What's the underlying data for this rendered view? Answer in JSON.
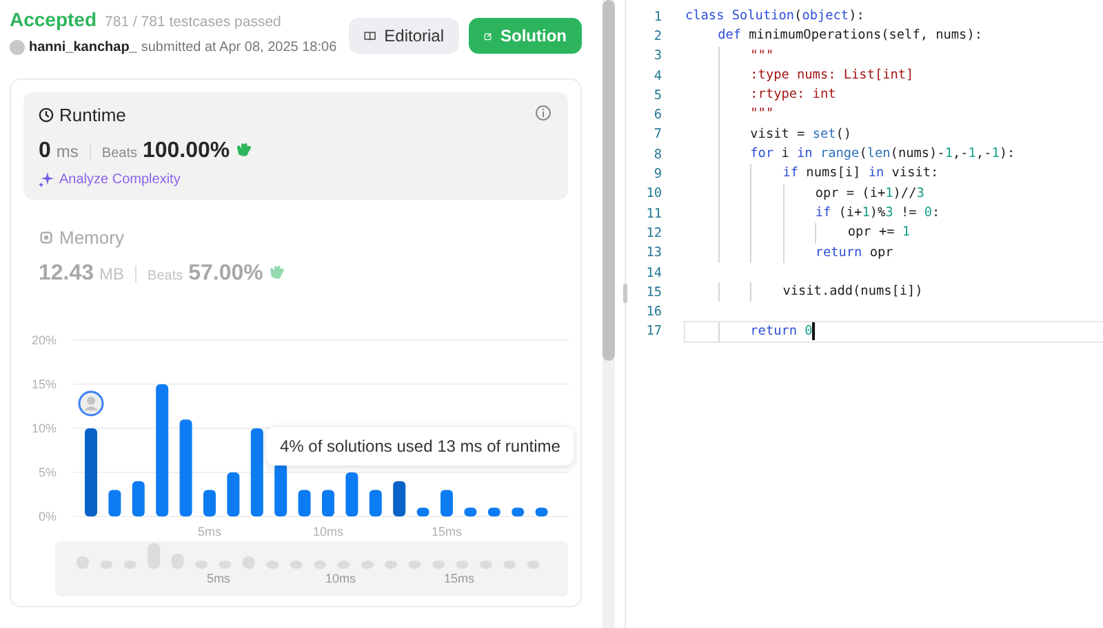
{
  "header": {
    "status": "Accepted",
    "testcases": "781 / 781 testcases passed",
    "user": "hanni_kanchap_",
    "submitted": "submitted at Apr 08, 2025 18:06"
  },
  "buttons": [
    {
      "label": "Editorial",
      "kind": "secondary"
    },
    {
      "label": "Solution",
      "kind": "primary"
    }
  ],
  "metrics": [
    {
      "kind": "runtime",
      "title": "Runtime",
      "value": "0",
      "unit": "ms",
      "beats_label": "Beats",
      "beats": "100.00%",
      "selected": true,
      "link": "Analyze Complexity"
    },
    {
      "kind": "memory",
      "title": "Memory",
      "value": "12.43",
      "unit": "MB",
      "beats_label": "Beats",
      "beats": "57.00%",
      "selected": false
    }
  ],
  "distribution": {
    "tooltip": "4% of solutions used 13 ms of runtime",
    "navigator_labels": [
      "5ms",
      "10ms",
      "15ms"
    ],
    "chart_data": {
      "type": "bar",
      "stacked": true,
      "grid": true,
      "x": [
        0,
        1,
        2,
        3,
        4,
        5,
        6,
        7,
        8,
        9,
        10,
        11,
        12,
        13,
        14,
        15,
        16,
        17,
        18,
        19
      ],
      "series": [
        {
          "color": "#0d7cf2",
          "values": [
            null,
            3,
            4,
            15,
            11,
            3,
            5,
            10,
            6,
            3,
            3,
            5,
            3,
            null,
            1,
            3,
            1,
            1,
            1,
            1
          ]
        },
        {
          "color": "#0a63c9",
          "values": [
            10,
            null,
            null,
            null,
            null,
            null,
            null,
            null,
            null,
            null,
            null,
            null,
            null,
            4,
            null,
            null,
            null,
            null,
            null,
            null
          ]
        }
      ],
      "xlim": [
        -0.5,
        19.5
      ],
      "ylim": [
        0,
        20
      ],
      "yticks": [
        {
          "value": 0,
          "label": "0%"
        },
        {
          "value": 5,
          "label": "5%"
        },
        {
          "value": 10,
          "label": "10%"
        },
        {
          "value": 15,
          "label": "15%"
        },
        {
          "value": 20,
          "label": "20%"
        }
      ],
      "xticks": [
        {
          "value": 5,
          "label": "5ms"
        },
        {
          "value": 10,
          "label": "10ms"
        },
        {
          "value": 15,
          "label": "15ms"
        }
      ]
    }
  },
  "editor": {
    "lines": [
      {
        "number": "1",
        "active": false,
        "tokens": [
          {
            "kind": "kw",
            "text": "class"
          },
          {
            "kind": "kw",
            "text": " Solution"
          },
          {
            "kind": "plain",
            "text": "("
          },
          {
            "kind": "kw",
            "text": "object"
          },
          {
            "kind": "plain",
            "text": "):"
          }
        ]
      },
      {
        "number": "2",
        "active": false,
        "tokens": [
          {
            "kind": "kw",
            "text": "    def"
          },
          {
            "kind": "plain",
            "text": " minimumOperations(self, nums):"
          }
        ]
      },
      {
        "number": "3",
        "active": false,
        "tokens": [
          {
            "kind": "str",
            "text": "        \"\"\""
          }
        ]
      },
      {
        "number": "4",
        "active": false,
        "tokens": [
          {
            "kind": "str",
            "text": "        :type nums: List[int]"
          }
        ]
      },
      {
        "number": "5",
        "active": false,
        "tokens": [
          {
            "kind": "str",
            "text": "        :rtype: int"
          }
        ]
      },
      {
        "number": "6",
        "active": false,
        "tokens": [
          {
            "kind": "str",
            "text": "        \"\"\""
          }
        ]
      },
      {
        "number": "7",
        "active": false,
        "tokens": [
          {
            "kind": "plain",
            "text": "        visit = "
          },
          {
            "kind": "builtin",
            "text": "set"
          },
          {
            "kind": "plain",
            "text": "()"
          }
        ]
      },
      {
        "number": "8",
        "active": false,
        "tokens": [
          {
            "kind": "kw",
            "text": "        for"
          },
          {
            "kind": "plain",
            "text": " i "
          },
          {
            "kind": "kw",
            "text": "in"
          },
          {
            "kind": "builtin",
            "text": " range"
          },
          {
            "kind": "plain",
            "text": "("
          },
          {
            "kind": "builtin",
            "text": "len"
          },
          {
            "kind": "plain",
            "text": "(nums)-"
          },
          {
            "kind": "num",
            "text": "1"
          },
          {
            "kind": "plain",
            "text": ",-"
          },
          {
            "kind": "num",
            "text": "1"
          },
          {
            "kind": "plain",
            "text": ",-"
          },
          {
            "kind": "num",
            "text": "1"
          },
          {
            "kind": "plain",
            "text": "):"
          }
        ]
      },
      {
        "number": "9",
        "active": false,
        "tokens": [
          {
            "kind": "kw",
            "text": "            if"
          },
          {
            "kind": "plain",
            "text": " nums[i] "
          },
          {
            "kind": "kw",
            "text": "in"
          },
          {
            "kind": "plain",
            "text": " visit:"
          }
        ]
      },
      {
        "number": "10",
        "active": false,
        "tokens": [
          {
            "kind": "plain",
            "text": "                opr = (i+"
          },
          {
            "kind": "num",
            "text": "1"
          },
          {
            "kind": "plain",
            "text": ")//"
          },
          {
            "kind": "num",
            "text": "3"
          }
        ]
      },
      {
        "number": "11",
        "active": false,
        "tokens": [
          {
            "kind": "kw",
            "text": "                if"
          },
          {
            "kind": "plain",
            "text": " (i+"
          },
          {
            "kind": "num",
            "text": "1"
          },
          {
            "kind": "plain",
            "text": ")%"
          },
          {
            "kind": "num",
            "text": "3"
          },
          {
            "kind": "plain",
            "text": " != "
          },
          {
            "kind": "num",
            "text": "0"
          },
          {
            "kind": "plain",
            "text": ":"
          }
        ]
      },
      {
        "number": "12",
        "active": false,
        "tokens": [
          {
            "kind": "plain",
            "text": "                    opr += "
          },
          {
            "kind": "num",
            "text": "1"
          }
        ]
      },
      {
        "number": "13",
        "active": false,
        "tokens": [
          {
            "kind": "kw",
            "text": "                return"
          },
          {
            "kind": "plain",
            "text": " opr"
          }
        ]
      },
      {
        "number": "14",
        "active": false
      },
      {
        "number": "15",
        "active": false,
        "tokens": [
          {
            "kind": "plain",
            "text": "            visit.add(nums[i])"
          }
        ]
      },
      {
        "number": "16",
        "active": false
      },
      {
        "number": "17",
        "active": true,
        "tokens": [
          {
            "kind": "kw",
            "text": "        return"
          },
          {
            "kind": "num",
            "text": " 0"
          }
        ]
      }
    ]
  }
}
